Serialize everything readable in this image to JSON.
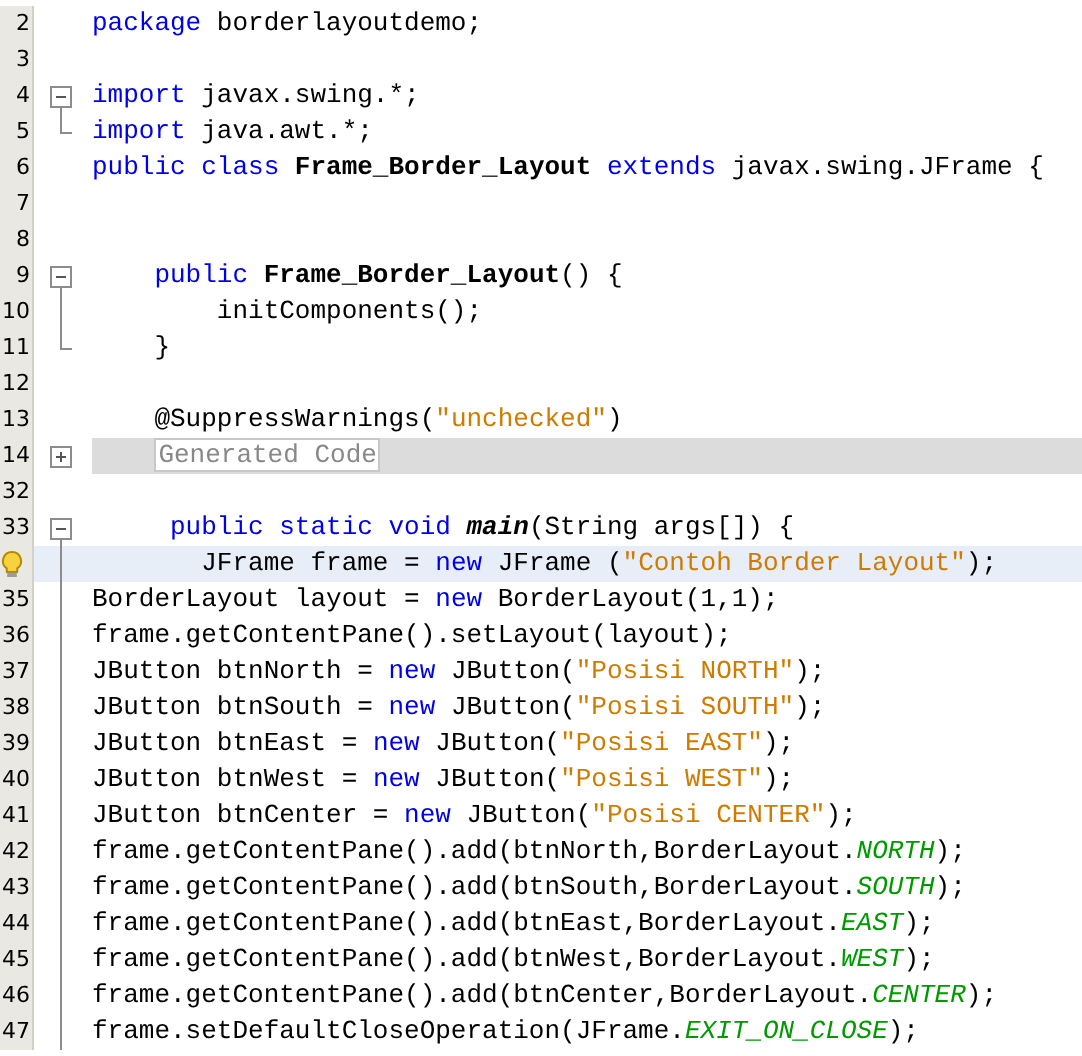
{
  "editor": {
    "lines": [
      {
        "number": "2",
        "current": false,
        "tokens": [
          {
            "kind": "keyword",
            "text": "package"
          },
          {
            "kind": "plain",
            "text": " borderlayoutdemo;"
          }
        ]
      },
      {
        "number": "3",
        "current": false
      },
      {
        "number": "4",
        "kind": "fold-start",
        "current": false,
        "tokens": [
          {
            "kind": "keyword",
            "text": "import"
          },
          {
            "kind": "plain",
            "text": " javax.swing.*;"
          }
        ]
      },
      {
        "number": "5",
        "kind": "fold-end",
        "current": false,
        "tokens": [
          {
            "kind": "keyword",
            "text": "import"
          },
          {
            "kind": "plain",
            "text": " java.awt.*;"
          }
        ]
      },
      {
        "number": "6",
        "current": false,
        "tokens": [
          {
            "kind": "keyword",
            "text": "public class"
          },
          {
            "kind": "declaration",
            "text": " Frame_Border_Layout"
          },
          {
            "kind": "keyword",
            "text": " extends"
          },
          {
            "kind": "plain",
            "text": " javax.swing.JFrame {"
          }
        ]
      },
      {
        "number": "7",
        "current": false
      },
      {
        "number": "8",
        "current": false
      },
      {
        "number": "9",
        "kind": "fold-start",
        "current": false,
        "tokens": [
          {
            "kind": "keyword",
            "text": "    public"
          },
          {
            "kind": "declaration",
            "text": " Frame_Border_Layout"
          },
          {
            "kind": "plain",
            "text": "() {"
          }
        ]
      },
      {
        "number": "10",
        "kind": "fold-body",
        "current": false,
        "tokens": [
          {
            "kind": "plain",
            "text": "        initComponents();"
          }
        ]
      },
      {
        "number": "11",
        "kind": "fold-end",
        "current": false,
        "tokens": [
          {
            "kind": "plain",
            "text": "    }"
          }
        ]
      },
      {
        "number": "12",
        "current": false
      },
      {
        "number": "13",
        "current": false,
        "tokens": [
          {
            "kind": "plain",
            "text": "    @SuppressWarnings("
          },
          {
            "kind": "string",
            "text": "\"unchecked\""
          },
          {
            "kind": "plain",
            "text": ")"
          }
        ]
      },
      {
        "number": "14",
        "kind": "folded",
        "current": false,
        "tokens": [
          {
            "kind": "folded",
            "text": "Generated Code"
          }
        ]
      },
      {
        "number": "32",
        "current": false
      },
      {
        "number": "33",
        "kind": "fold-start",
        "current": false,
        "tokens": [
          {
            "kind": "keyword",
            "text": "     public static void"
          },
          {
            "kind": "method",
            "text": " main"
          },
          {
            "kind": "plain",
            "text": "(String args[]) {"
          }
        ]
      },
      {
        "hint": true,
        "kind": "fold-body",
        "current": true,
        "tokens": [
          {
            "kind": "plain",
            "text": "       JFrame frame = "
          },
          {
            "kind": "keyword",
            "text": "new"
          },
          {
            "kind": "plain",
            "text": " JFrame ("
          },
          {
            "kind": "string",
            "text": "\"Contoh Border Layout\""
          },
          {
            "kind": "plain",
            "text": ");"
          }
        ]
      },
      {
        "number": "35",
        "kind": "fold-body",
        "current": false,
        "tokens": [
          {
            "kind": "plain",
            "text": "BorderLayout layout = "
          },
          {
            "kind": "keyword",
            "text": "new"
          },
          {
            "kind": "plain",
            "text": " BorderLayout(1,1);"
          }
        ]
      },
      {
        "number": "36",
        "kind": "fold-body",
        "current": false,
        "tokens": [
          {
            "kind": "plain",
            "text": "frame.getContentPane().setLayout(layout);"
          }
        ]
      },
      {
        "number": "37",
        "kind": "fold-body",
        "current": false,
        "tokens": [
          {
            "kind": "plain",
            "text": "JButton btnNorth = "
          },
          {
            "kind": "keyword",
            "text": "new"
          },
          {
            "kind": "plain",
            "text": " JButton("
          },
          {
            "kind": "string",
            "text": "\"Posisi NORTH\""
          },
          {
            "kind": "plain",
            "text": ");"
          }
        ]
      },
      {
        "number": "38",
        "kind": "fold-body",
        "current": false,
        "tokens": [
          {
            "kind": "plain",
            "text": "JButton btnSouth = "
          },
          {
            "kind": "keyword",
            "text": "new"
          },
          {
            "kind": "plain",
            "text": " JButton("
          },
          {
            "kind": "string",
            "text": "\"Posisi SOUTH\""
          },
          {
            "kind": "plain",
            "text": ");"
          }
        ]
      },
      {
        "number": "39",
        "kind": "fold-body",
        "current": false,
        "tokens": [
          {
            "kind": "plain",
            "text": "JButton btnEast = "
          },
          {
            "kind": "keyword",
            "text": "new"
          },
          {
            "kind": "plain",
            "text": " JButton("
          },
          {
            "kind": "string",
            "text": "\"Posisi EAST\""
          },
          {
            "kind": "plain",
            "text": ");"
          }
        ]
      },
      {
        "number": "40",
        "kind": "fold-body",
        "current": false,
        "tokens": [
          {
            "kind": "plain",
            "text": "JButton btnWest = "
          },
          {
            "kind": "keyword",
            "text": "new"
          },
          {
            "kind": "plain",
            "text": " JButton("
          },
          {
            "kind": "string",
            "text": "\"Posisi WEST\""
          },
          {
            "kind": "plain",
            "text": ");"
          }
        ]
      },
      {
        "number": "41",
        "kind": "fold-body",
        "current": false,
        "tokens": [
          {
            "kind": "plain",
            "text": "JButton btnCenter = "
          },
          {
            "kind": "keyword",
            "text": "new"
          },
          {
            "kind": "plain",
            "text": " JButton("
          },
          {
            "kind": "string",
            "text": "\"Posisi CENTER\""
          },
          {
            "kind": "plain",
            "text": ");"
          }
        ]
      },
      {
        "number": "42",
        "kind": "fold-body",
        "current": false,
        "tokens": [
          {
            "kind": "plain",
            "text": "frame.getContentPane().add(btnNorth,BorderLayout."
          },
          {
            "kind": "constant",
            "text": "NORTH"
          },
          {
            "kind": "plain",
            "text": ");"
          }
        ]
      },
      {
        "number": "43",
        "kind": "fold-body",
        "current": false,
        "tokens": [
          {
            "kind": "plain",
            "text": "frame.getContentPane().add(btnSouth,BorderLayout."
          },
          {
            "kind": "constant",
            "text": "SOUTH"
          },
          {
            "kind": "plain",
            "text": ");"
          }
        ]
      },
      {
        "number": "44",
        "kind": "fold-body",
        "current": false,
        "tokens": [
          {
            "kind": "plain",
            "text": "frame.getContentPane().add(btnEast,BorderLayout."
          },
          {
            "kind": "constant",
            "text": "EAST"
          },
          {
            "kind": "plain",
            "text": ");"
          }
        ]
      },
      {
        "number": "45",
        "kind": "fold-body",
        "current": false,
        "tokens": [
          {
            "kind": "plain",
            "text": "frame.getContentPane().add(btnWest,BorderLayout."
          },
          {
            "kind": "constant",
            "text": "WEST"
          },
          {
            "kind": "plain",
            "text": ");"
          }
        ]
      },
      {
        "number": "46",
        "kind": "fold-body",
        "current": false,
        "tokens": [
          {
            "kind": "plain",
            "text": "frame.getContentPane().add(btnCenter,BorderLayout."
          },
          {
            "kind": "constant",
            "text": "CENTER"
          },
          {
            "kind": "plain",
            "text": ");"
          }
        ]
      },
      {
        "number": "47",
        "kind": "fold-body",
        "current": false,
        "tokens": [
          {
            "kind": "plain",
            "text": "frame.setDefaultCloseOperation(JFrame."
          },
          {
            "kind": "constant",
            "text": "EXIT_ON_CLOSE"
          },
          {
            "kind": "plain",
            "text": ");"
          }
        ]
      }
    ]
  }
}
